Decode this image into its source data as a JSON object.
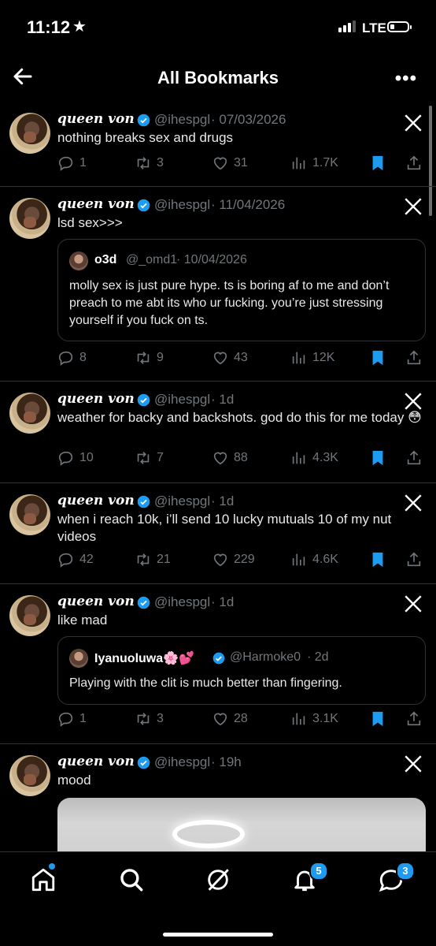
{
  "status_bar": {
    "time": "11:12",
    "network": "LTE"
  },
  "header": {
    "title": "All Bookmarks"
  },
  "tweets": [
    {
      "name": "queen von",
      "handle": "@ihespgl",
      "date": "· 07/03/2026",
      "text": "nothing breaks sex and drugs",
      "replies": "1",
      "retweets": "3",
      "likes": "31",
      "views": "1.7K"
    },
    {
      "name": "queen von",
      "handle": "@ihespgl",
      "date": "· 11/04/2026",
      "text": "lsd sex>>>",
      "quote": {
        "name": "o3d",
        "handle": "@_omd1",
        "date": "· 10/04/2026",
        "text": "molly sex is just pure hype. ts is boring af to me and don’t preach to me abt its who ur fucking. you’re just stressing yourself if you fuck on ts."
      },
      "replies": "8",
      "retweets": "9",
      "likes": "43",
      "views": "12K"
    },
    {
      "name": "queen von",
      "handle": "@ihespgl",
      "date": "· 1d",
      "text": "weather for backy and backshots. god do this for me today 😳",
      "replies": "10",
      "retweets": "7",
      "likes": "88",
      "views": "4.3K"
    },
    {
      "name": "queen von",
      "handle": "@ihespgl",
      "date": "· 1d",
      "text": "when i reach 10k, i’ll send 10 lucky mutuals 10 of my nut videos",
      "replies": "42",
      "retweets": "21",
      "likes": "229",
      "views": "4.6K"
    },
    {
      "name": "queen von",
      "handle": "@ihespgl",
      "date": "· 1d",
      "text": "like mad",
      "quote": {
        "name": "Iyanuoluwa🌸💕",
        "handle": "@Harmoke0",
        "date": "· 2d",
        "text": "Playing with the clit is much better than fingering."
      },
      "replies": "1",
      "retweets": "3",
      "likes": "28",
      "views": "3.1K"
    },
    {
      "name": "queen von",
      "handle": "@ihespgl",
      "date": "· 19h",
      "text": "mood"
    }
  ],
  "bottom_nav": {
    "notifications_badge": "5",
    "messages_badge": "3"
  },
  "colors": {
    "accent": "#1d9bf0",
    "muted": "#71767b",
    "divider": "#2f3336"
  }
}
